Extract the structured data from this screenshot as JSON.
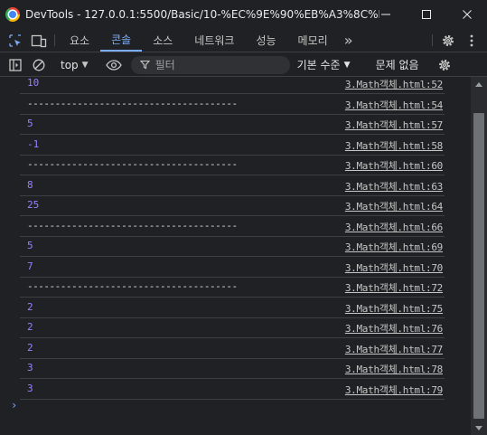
{
  "window": {
    "title": "DevTools - 127.0.0.1:5500/Basic/10-%EC%9E%90%EB%A3%8C%ED..."
  },
  "tabs": [
    {
      "label": "요소"
    },
    {
      "label": "콘솔"
    },
    {
      "label": "소스"
    },
    {
      "label": "네트워크"
    },
    {
      "label": "성능"
    },
    {
      "label": "메모리"
    }
  ],
  "tabs_more": "»",
  "toolbar": {
    "context": "top",
    "filter_placeholder": "필터",
    "levels": "기본 수준",
    "issues": "문제 없음"
  },
  "console_rows": [
    {
      "value": "10",
      "source": "3.Math객체.html:52",
      "kind": "number"
    },
    {
      "value": "--------------------------------------",
      "source": "3.Math객체.html:54",
      "kind": "string"
    },
    {
      "value": "5",
      "source": "3.Math객체.html:57",
      "kind": "number"
    },
    {
      "value": "-1",
      "source": "3.Math객체.html:58",
      "kind": "number"
    },
    {
      "value": "--------------------------------------",
      "source": "3.Math객체.html:60",
      "kind": "string"
    },
    {
      "value": "8",
      "source": "3.Math객체.html:63",
      "kind": "number"
    },
    {
      "value": "25",
      "source": "3.Math객체.html:64",
      "kind": "number"
    },
    {
      "value": "--------------------------------------",
      "source": "3.Math객체.html:66",
      "kind": "string"
    },
    {
      "value": "5",
      "source": "3.Math객체.html:69",
      "kind": "number"
    },
    {
      "value": "7",
      "source": "3.Math객체.html:70",
      "kind": "number"
    },
    {
      "value": "--------------------------------------",
      "source": "3.Math객체.html:72",
      "kind": "string"
    },
    {
      "value": "2",
      "source": "3.Math객체.html:75",
      "kind": "number"
    },
    {
      "value": "2",
      "source": "3.Math객체.html:76",
      "kind": "number"
    },
    {
      "value": "2",
      "source": "3.Math객체.html:77",
      "kind": "number"
    },
    {
      "value": "3",
      "source": "3.Math객체.html:78",
      "kind": "number"
    },
    {
      "value": "3",
      "source": "3.Math객체.html:79",
      "kind": "number"
    }
  ],
  "prompt_glyph": "›",
  "colors": {
    "background": "#202124",
    "accent": "#7cacf8",
    "number": "#9980ff",
    "divider": "#3c4043"
  }
}
